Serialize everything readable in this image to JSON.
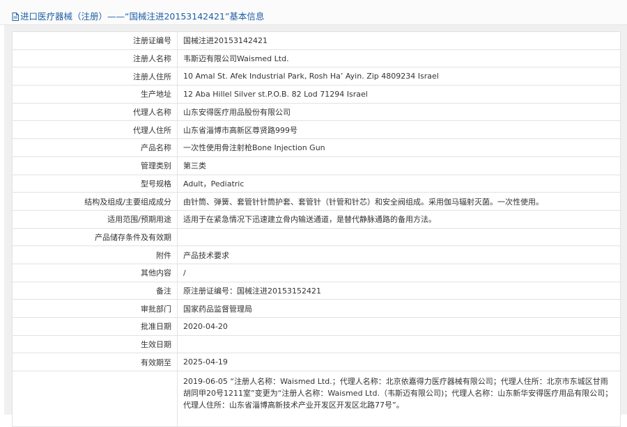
{
  "header": {
    "title": "进口医疗器械（注册）——“国械注进20153142421”基本信息"
  },
  "rows": [
    {
      "label": "注册证编号",
      "value": "国械注进20153142421"
    },
    {
      "label": "注册人名称",
      "value": "韦斯迈有限公司Waismed Ltd."
    },
    {
      "label": "注册人住所",
      "value": "10 Amal St. Afek Industrial Park, Rosh Ha’ Ayin. Zip 4809234 Israel"
    },
    {
      "label": "生产地址",
      "value": "12 Aba Hillel Silver st.P.O.B. 82 Lod 71294 Israel"
    },
    {
      "label": "代理人名称",
      "value": "山东安得医疗用品股份有限公司"
    },
    {
      "label": "代理人住所",
      "value": "山东省淄博市高新区尊贤路999号"
    },
    {
      "label": "产品名称",
      "value": "一次性使用骨注射枪Bone Injection Gun"
    },
    {
      "label": "管理类别",
      "value": "第三类"
    },
    {
      "label": "型号规格",
      "value": "Adult，Pediatric"
    },
    {
      "label": "结构及组成/主要组成成分",
      "value": "由针筒、弹簧、套管针针筒护套、套管针（针管和针芯）和安全阀组成。采用伽马辐射灭菌。一次性使用。"
    },
    {
      "label": "适用范围/预期用途",
      "value": "适用于在紧急情况下迅速建立骨内输送通道，是替代静脉通路的备用方法。"
    },
    {
      "label": "产品储存条件及有效期",
      "value": ""
    },
    {
      "label": "附件",
      "value": "产品技术要求"
    },
    {
      "label": "其他内容",
      "value": "/"
    },
    {
      "label": "备注",
      "value": "原注册证编号：国械注进20153152421"
    },
    {
      "label": "审批部门",
      "value": "国家药品监督管理局"
    },
    {
      "label": "批准日期",
      "value": "2020-04-20"
    },
    {
      "label": "生效日期",
      "value": ""
    },
    {
      "label": "有效期至",
      "value": "2025-04-19"
    }
  ],
  "change_record": {
    "label": "",
    "value": "2019-06-05 “注册人名称：Waismed Ltd.；代理人名称：北京依嘉得力医疗器械有限公司；代理人住所：北京市东城区甘雨胡同甲20号1211室”变更为“注册人名称：Waismed Ltd.（韦斯迈有限公司)；代理人名称：山东新华安得医疗用品有限公司；代理人住所：山东省淄博高新技术产业开发区开发区北路77号”。"
  }
}
